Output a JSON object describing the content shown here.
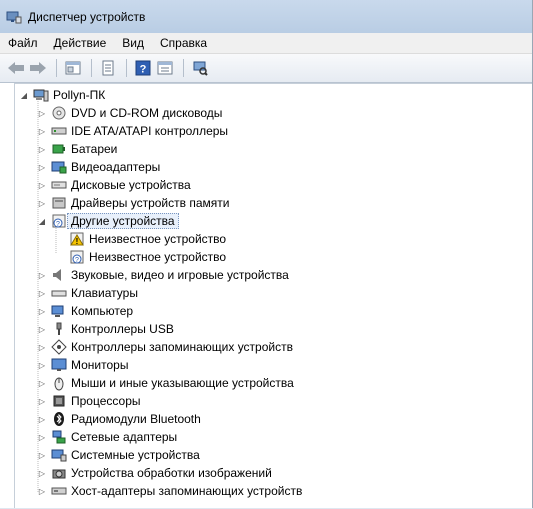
{
  "window": {
    "title": "Диспетчер устройств"
  },
  "menu": [
    "Файл",
    "Действие",
    "Вид",
    "Справка"
  ],
  "toolbar": [
    "back-icon",
    "forward-icon",
    "properties-icon",
    "details-icon",
    "help-icon",
    "view-icon",
    "scan-hardware-icon"
  ],
  "tree": {
    "root": "Pollyn-ПК",
    "categories": [
      {
        "label": "DVD и CD-ROM дисководы",
        "icon": "dvd-drive-icon"
      },
      {
        "label": "IDE ATA/ATAPI контроллеры",
        "icon": "ide-controller-icon"
      },
      {
        "label": "Батареи",
        "icon": "battery-icon"
      },
      {
        "label": "Видеоадаптеры",
        "icon": "display-adapter-icon"
      },
      {
        "label": "Дисковые устройства",
        "icon": "disk-drive-icon"
      },
      {
        "label": "Драйверы устройств памяти",
        "icon": "memory-driver-icon"
      },
      {
        "label": "Другие устройства",
        "icon": "other-devices-icon",
        "expanded": true,
        "children": [
          {
            "label": "Неизвестное устройство",
            "icon": "unknown-device-warning-icon"
          },
          {
            "label": "Неизвестное устройство",
            "icon": "unknown-device-icon"
          }
        ]
      },
      {
        "label": "Звуковые, видео и игровые устройства",
        "icon": "sound-icon"
      },
      {
        "label": "Клавиатуры",
        "icon": "keyboard-icon"
      },
      {
        "label": "Компьютер",
        "icon": "computer-icon"
      },
      {
        "label": "Контроллеры USB",
        "icon": "usb-icon"
      },
      {
        "label": "Контроллеры запоминающих устройств",
        "icon": "storage-controller-icon"
      },
      {
        "label": "Мониторы",
        "icon": "monitor-icon"
      },
      {
        "label": "Мыши и иные указывающие устройства",
        "icon": "mouse-icon"
      },
      {
        "label": "Процессоры",
        "icon": "processor-icon"
      },
      {
        "label": "Радиомодули Bluetooth",
        "icon": "bluetooth-icon"
      },
      {
        "label": "Сетевые адаптеры",
        "icon": "network-adapter-icon"
      },
      {
        "label": "Системные устройства",
        "icon": "system-devices-icon"
      },
      {
        "label": "Устройства обработки изображений",
        "icon": "imaging-devices-icon"
      },
      {
        "label": "Хост-адаптеры запоминающих устройств",
        "icon": "storage-host-adapter-icon"
      }
    ]
  }
}
